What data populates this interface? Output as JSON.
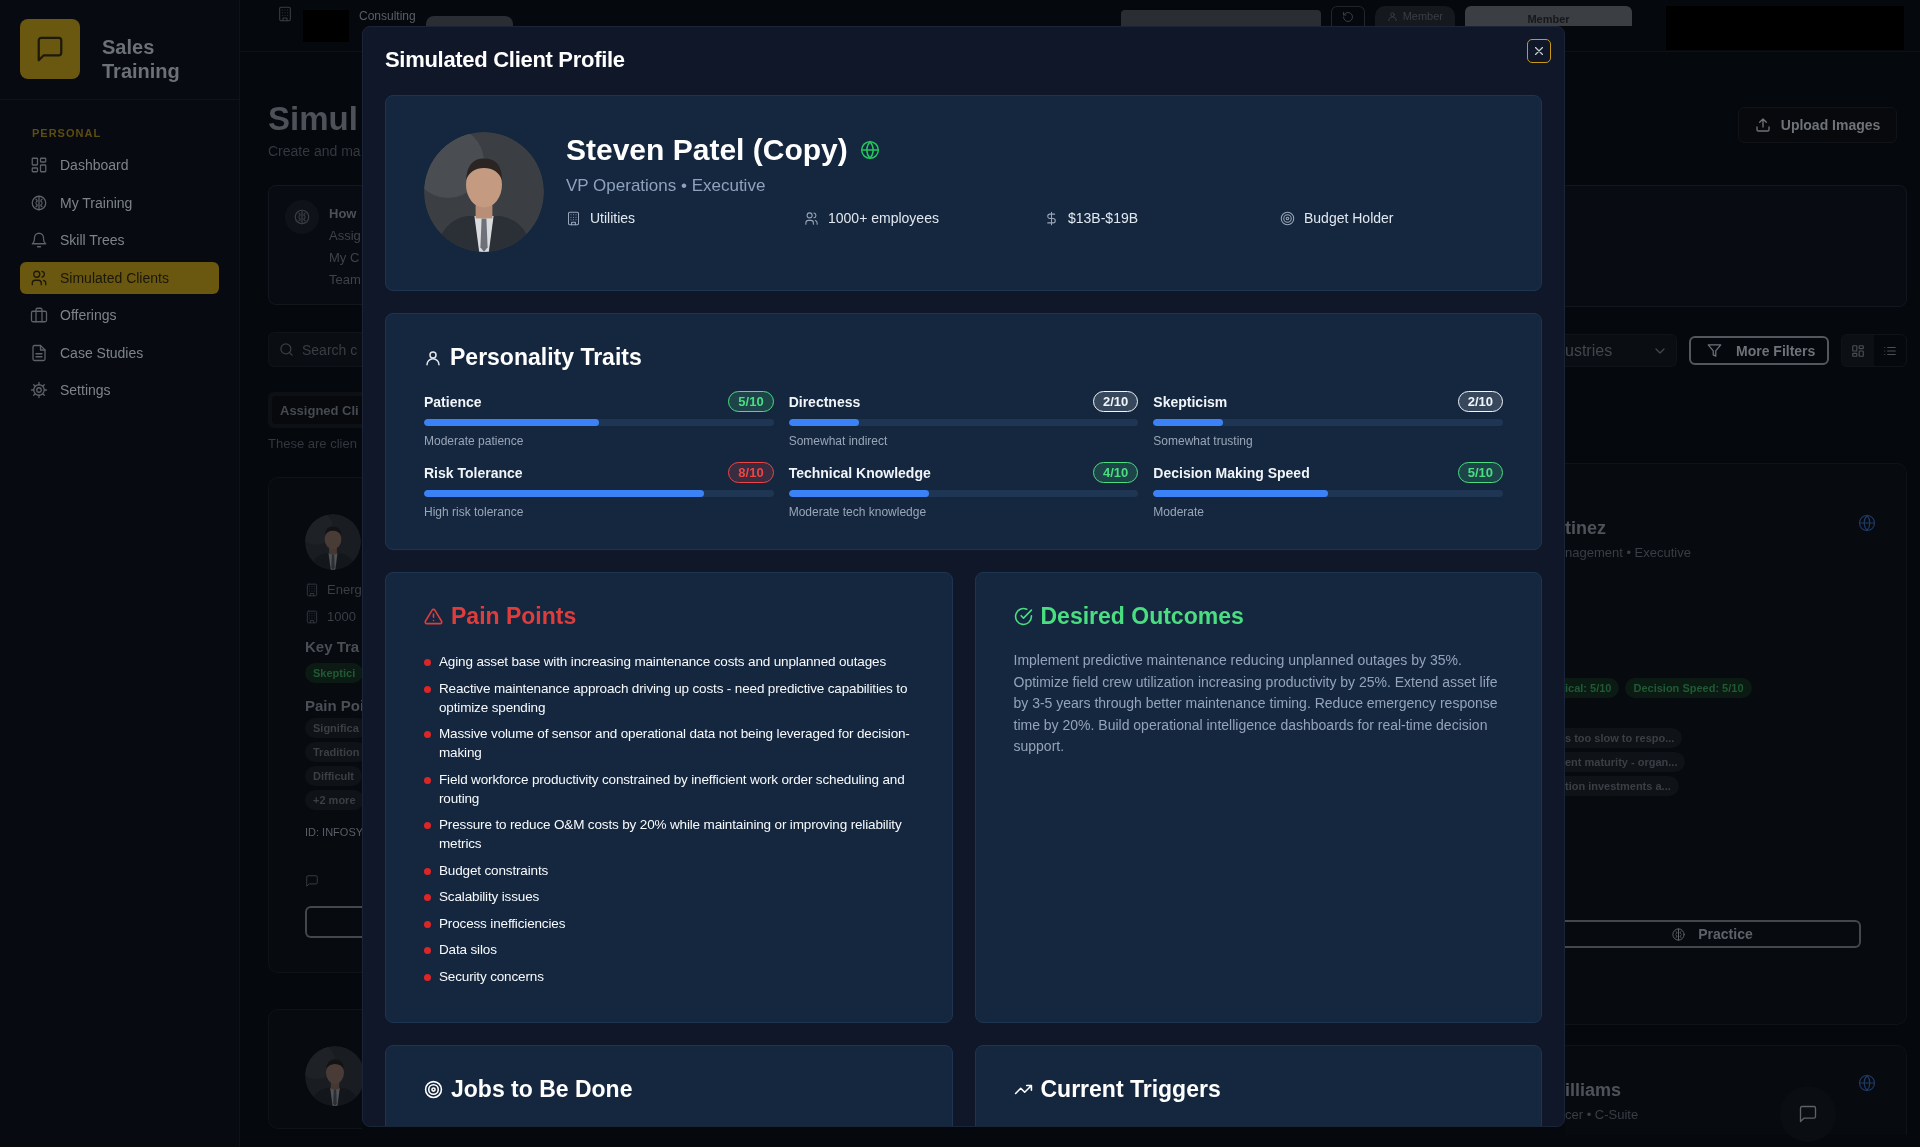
{
  "app": {
    "title": "Sales Training"
  },
  "sidebar": {
    "section": "PERSONAL",
    "items": [
      {
        "label": "Dashboard",
        "selected": false
      },
      {
        "label": "My Training",
        "selected": false
      },
      {
        "label": "Skill Trees",
        "selected": false
      },
      {
        "label": "Simulated Clients",
        "selected": true
      },
      {
        "label": "Offerings",
        "selected": false
      },
      {
        "label": "Case Studies",
        "selected": false
      },
      {
        "label": "Settings",
        "selected": false
      }
    ]
  },
  "top_bar": {
    "org": "Consulting",
    "role_badge": "Member",
    "role_button": "Member"
  },
  "background_left": {
    "page_title": "Simul",
    "subtitle": "Create and ma",
    "info": {
      "heading": "How",
      "lines": [
        "Assig",
        "My C",
        "Team"
      ]
    },
    "search": {
      "placeholder": "Search c"
    },
    "tab": "Assigned Cli",
    "note": "These are clien",
    "card": {
      "facts": [
        "Energ",
        "1000"
      ],
      "traits_heading": "Key Tra",
      "traits": [
        "Skeptici"
      ],
      "pains_heading": "Pain Poi",
      "pains": [
        "Significa",
        "Tradition",
        "Difficult"
      ],
      "more": "+2 more",
      "id": "ID: INFOSY"
    }
  },
  "background_right": {
    "upload": "Upload Images",
    "industry_filter": "ustries",
    "more_filters": "More Filters",
    "card": {
      "name": "tinez",
      "role": "nagement • Executive",
      "traits": [
        "ical: 5/10",
        "Decision Speed: 5/10"
      ],
      "pains": [
        "s too slow to respo...",
        "ent maturity - organ...",
        "tion investments a..."
      ],
      "action": "Practice"
    },
    "card_2": {
      "name": "illiams",
      "role": "cer • C-Suite"
    }
  },
  "modal": {
    "title": "Simulated Client Profile",
    "client": {
      "name": "Steven Patel (Copy)",
      "role": "VP Operations • Executive",
      "facts": [
        "Utilities",
        "1000+ employees",
        "$13B-$19B",
        "Budget Holder"
      ]
    },
    "traits": {
      "heading": "Personality Traits",
      "items": [
        {
          "name": "Patience",
          "score": "5/10",
          "color": "#4ade80",
          "level": 0.5,
          "note": "Moderate patience"
        },
        {
          "name": "Directness",
          "score": "2/10",
          "color": "#f1f5f9",
          "level": 0.2,
          "note": "Somewhat indirect"
        },
        {
          "name": "Skepticism",
          "score": "2/10",
          "color": "#f1f5f9",
          "level": 0.2,
          "note": "Somewhat trusting"
        },
        {
          "name": "Risk Tolerance",
          "score": "8/10",
          "color": "#ef4444",
          "level": 0.8,
          "note": "High risk tolerance"
        },
        {
          "name": "Technical Knowledge",
          "score": "4/10",
          "color": "#4ade80",
          "level": 0.4,
          "note": "Moderate tech knowledge"
        },
        {
          "name": "Decision Making Speed",
          "score": "5/10",
          "color": "#4ade80",
          "level": 0.5,
          "note": "Moderate"
        }
      ]
    },
    "pain_points": {
      "heading": "Pain Points",
      "items": [
        "Aging asset base with increasing maintenance costs and unplanned outages",
        "Reactive maintenance approach driving up costs - need predictive capabilities to optimize spending",
        "Massive volume of sensor and operational data not being leveraged for decision-making",
        "Field workforce productivity constrained by inefficient work order scheduling and routing",
        "Pressure to reduce O&M costs by 20% while maintaining or improving reliability metrics",
        "Budget constraints",
        "Scalability issues",
        "Process inefficiencies",
        "Data silos",
        "Security concerns"
      ]
    },
    "desired_outcomes": {
      "heading": "Desired Outcomes",
      "text": "Implement predictive maintenance reducing unplanned outages by 35%. Optimize field crew utilization increasing productivity by 25%. Extend asset life by 3-5 years through better maintenance timing. Reduce emergency response time by 20%. Build operational intelligence dashboards for real-time decision support."
    },
    "jobs": {
      "heading": "Jobs to Be Done"
    },
    "triggers": {
      "heading": "Current Triggers"
    }
  }
}
